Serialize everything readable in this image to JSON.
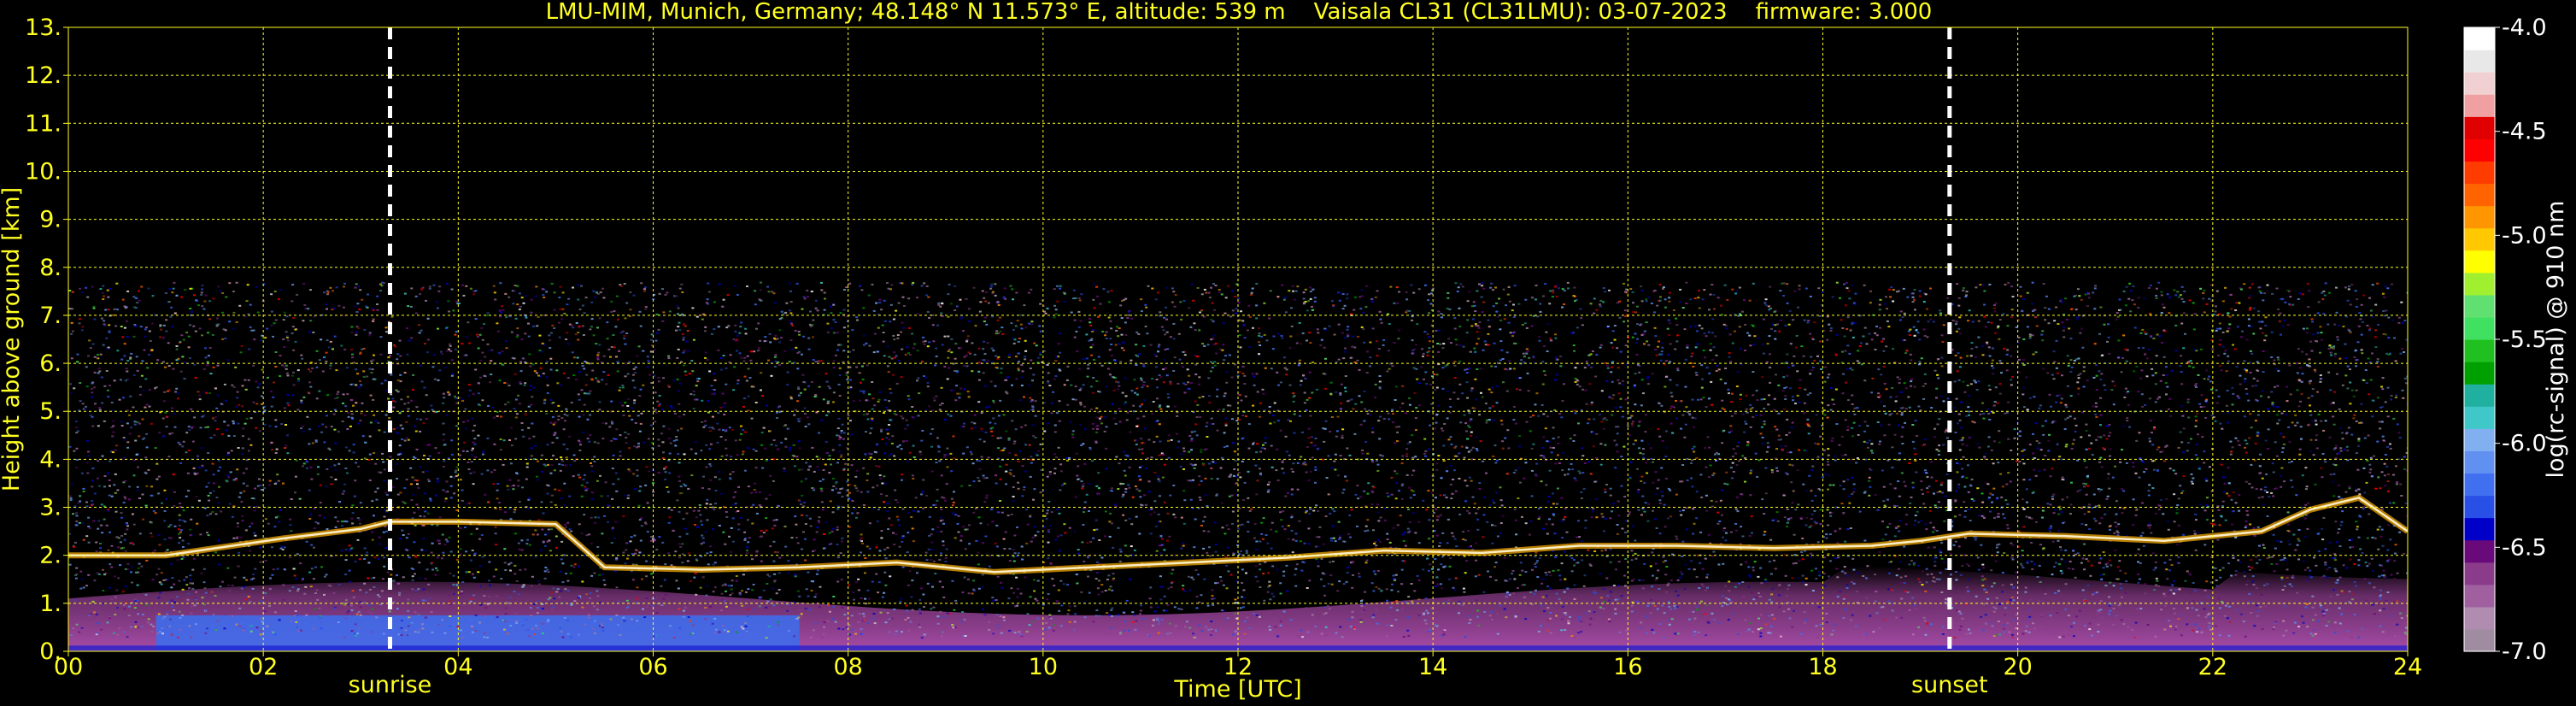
{
  "chart_data": {
    "type": "heatmap",
    "title": "LMU-MIM, Munich, Germany; 48.148° N 11.573° E, altitude: 539 m    Vaisala CL31 (CL31LMU): 03-07-2023    firmware: 3.000",
    "xlabel": "Time [UTC]",
    "ylabel": "Height above ground [km]",
    "xlim": [
      0,
      24
    ],
    "ylim": [
      0,
      13
    ],
    "x_ticks": [
      "00",
      "02",
      "04",
      "06",
      "08",
      "10",
      "12",
      "14",
      "16",
      "18",
      "20",
      "22",
      "24"
    ],
    "y_ticks": [
      "0.",
      "1.",
      "2.",
      "3.",
      "4.",
      "5.",
      "6.",
      "7.",
      "8.",
      "9.",
      "10.",
      "11.",
      "12.",
      "13."
    ],
    "grid": true,
    "colorbar": {
      "label": "log(rc-signal) @ 910 nm",
      "range": [
        -7.0,
        -4.0
      ],
      "ticks": [
        "-4.0",
        "-4.5",
        "-5.0",
        "-5.5",
        "-6.0",
        "-6.5",
        "-7.0"
      ],
      "colors": [
        "#a08ca0",
        "#b08cb0",
        "#a060a0",
        "#8a3c8a",
        "#6a0a7a",
        "#0000c8",
        "#2850e6",
        "#4070f0",
        "#6090f0",
        "#80b0f0",
        "#40c8c8",
        "#20b0a0",
        "#00a000",
        "#20c020",
        "#40e060",
        "#60e070",
        "#a0f030",
        "#ffff00",
        "#ffc800",
        "#ff9600",
        "#ff6400",
        "#ff3c00",
        "#ff0000",
        "#e00000",
        "#f0a0a0",
        "#f0d0d0",
        "#e8e8e8",
        "#ffffff"
      ]
    },
    "annotations": [
      {
        "label": "sunrise",
        "x": 3.3
      },
      {
        "label": "sunset",
        "x": 19.3
      }
    ],
    "signal_top_km": 7.7,
    "cloud_layer": [
      [
        0.0,
        2.0
      ],
      [
        1.0,
        2.0
      ],
      [
        2.2,
        2.35
      ],
      [
        3.0,
        2.55
      ],
      [
        3.3,
        2.7
      ],
      [
        4.0,
        2.7
      ],
      [
        5.0,
        2.65
      ],
      [
        5.5,
        1.75
      ],
      [
        6.5,
        1.7
      ],
      [
        7.5,
        1.75
      ],
      [
        8.5,
        1.85
      ],
      [
        9.5,
        1.65
      ],
      [
        10.5,
        1.75
      ],
      [
        11.5,
        1.85
      ],
      [
        12.5,
        1.95
      ],
      [
        13.5,
        2.1
      ],
      [
        14.5,
        2.05
      ],
      [
        15.5,
        2.2
      ],
      [
        16.5,
        2.2
      ],
      [
        17.5,
        2.15
      ],
      [
        18.5,
        2.2
      ],
      [
        19.0,
        2.3
      ],
      [
        19.5,
        2.45
      ],
      [
        20.5,
        2.4
      ],
      [
        21.5,
        2.3
      ],
      [
        22.5,
        2.5
      ],
      [
        23.0,
        2.95
      ],
      [
        23.5,
        3.2
      ],
      [
        24.0,
        2.5
      ]
    ]
  }
}
